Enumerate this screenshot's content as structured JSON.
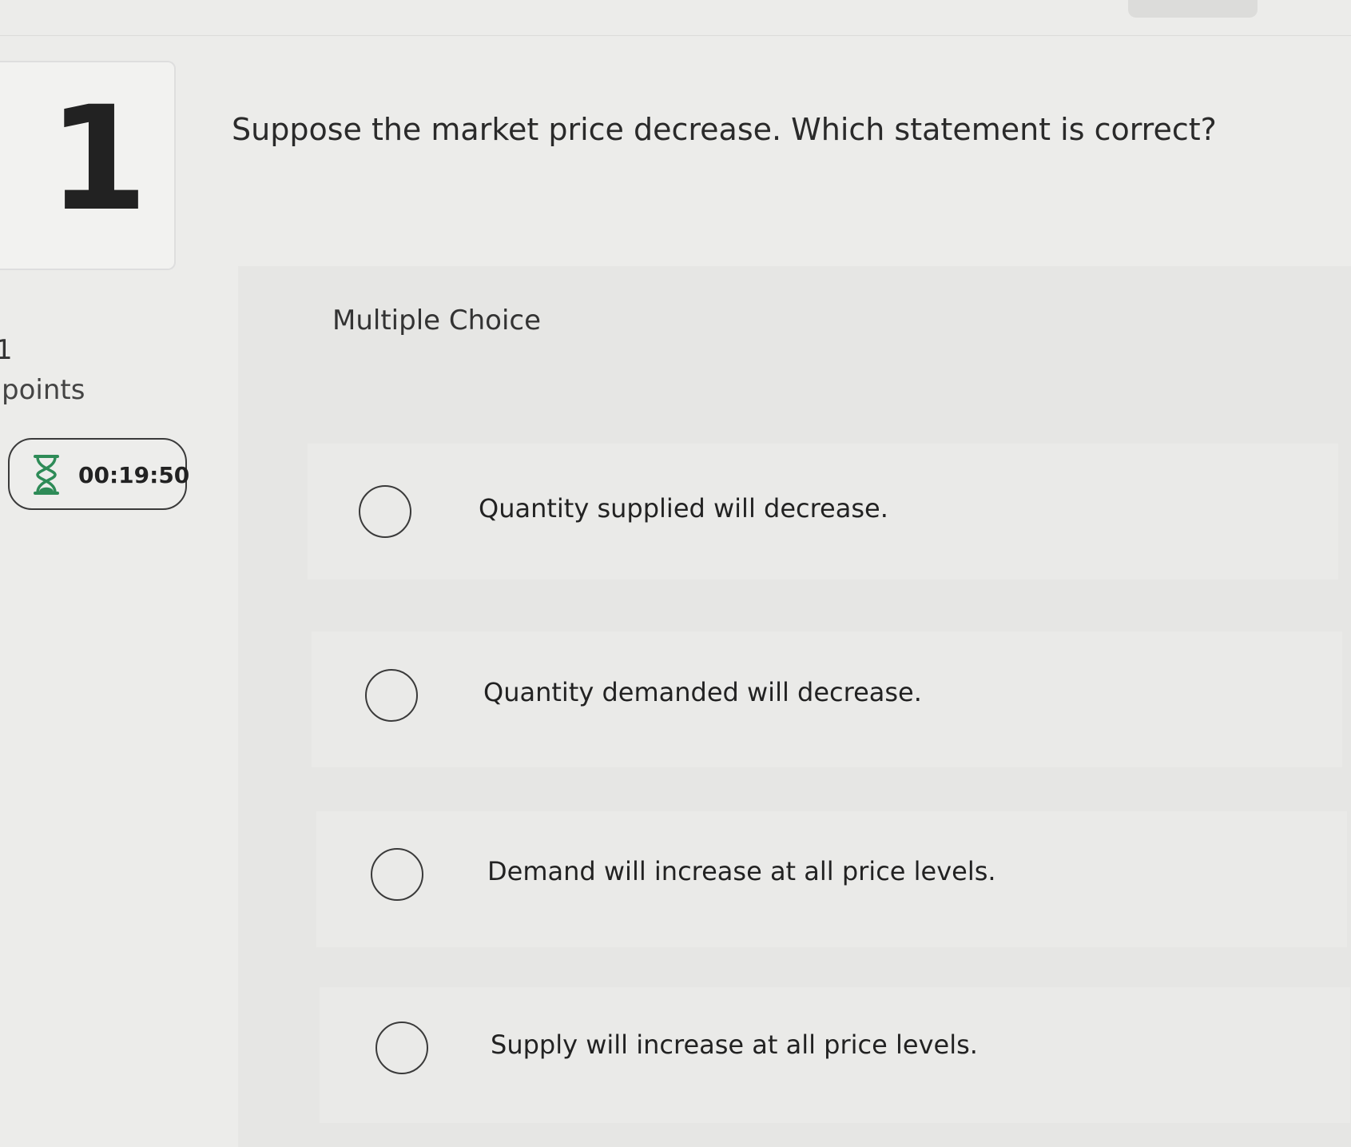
{
  "question": {
    "number": "1",
    "prompt": "Suppose the market price decrease. Which statement is correct?"
  },
  "points": {
    "value": "1",
    "label": "points"
  },
  "timer": {
    "icon": "hourglass-icon",
    "value": "00:19:50"
  },
  "choices": {
    "type_label": "Multiple Choice",
    "options": [
      {
        "text": "Quantity supplied will decrease."
      },
      {
        "text": "Quantity demanded will decrease."
      },
      {
        "text": "Demand will increase at all price levels."
      },
      {
        "text": "Supply will increase at all price levels."
      }
    ]
  },
  "colors": {
    "background": "#ececea",
    "panel": "#e6e6e4",
    "timer_icon": "#2e8b57",
    "text": "#222222"
  }
}
